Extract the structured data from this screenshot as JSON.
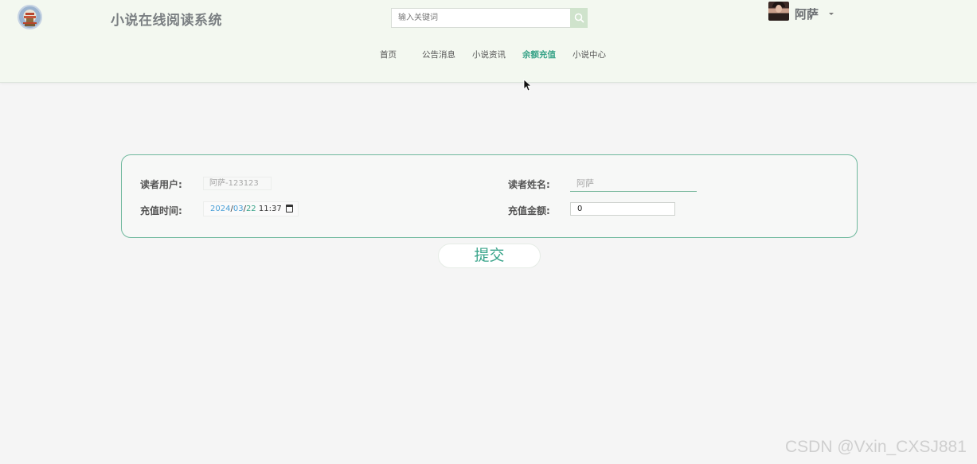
{
  "header": {
    "app_title": "小说在线阅读系统",
    "search": {
      "placeholder": "输入关键词",
      "value": ""
    },
    "user": {
      "name": "阿萨"
    },
    "nav": [
      {
        "label": "首页",
        "active": false
      },
      {
        "label": "公告消息",
        "active": false
      },
      {
        "label": "小说资讯",
        "active": false
      },
      {
        "label": "余额充值",
        "active": true
      },
      {
        "label": "小说中心",
        "active": false
      }
    ]
  },
  "form": {
    "reader_account": {
      "label": "读者用户:",
      "value": "阿萨-123123"
    },
    "reader_name": {
      "label": "读者姓名:",
      "value": "阿萨"
    },
    "recharge_time": {
      "label": "充值时间:",
      "year": "2024",
      "sep1": "/",
      "month": "03",
      "sep2": "/",
      "day": "22",
      "time": "11:37"
    },
    "recharge_amount": {
      "label": "充值金额:",
      "value": "0"
    },
    "submit_label": "提交"
  },
  "watermark": "CSDN @Vxin_CXSJ881",
  "colors": {
    "accent": "#3aa489",
    "header_bg": "#f3f8f0",
    "card_border": "#6fb89d"
  }
}
